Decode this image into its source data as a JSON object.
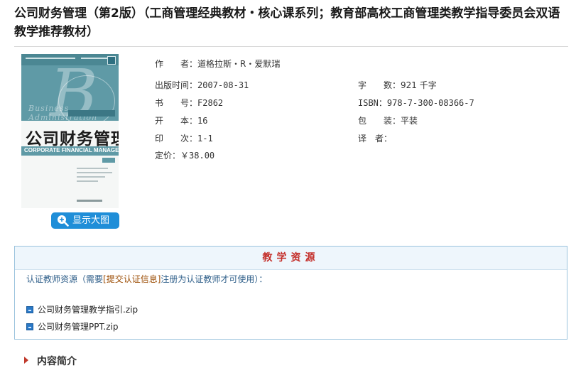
{
  "page_title": "公司财务管理（第2版）（工商管理经典教材・核心课系列；教育部高校工商管理类教学指导委员会双语教学推荐教材）",
  "cover": {
    "chinese_title": "公司财务管理",
    "english_title": "CORPORATE FINANCIAL MANAGEMENT",
    "enlarge_button": "显示大图"
  },
  "details": {
    "author_label": "作　　者：",
    "author_value": "道格拉斯・R・爱默瑞",
    "pubdate_label": "出版时间：",
    "pubdate_value": "2007-08-31",
    "wordcount_label": "字　　数：",
    "wordcount_value": "921 千字",
    "bookno_label": "书　　号：",
    "bookno_value": "F2862",
    "isbn_label": "ISBN：",
    "isbn_value": "978-7-300-08366-7",
    "format_label": "开　　本：",
    "format_value": "16",
    "binding_label": "包　　装：",
    "binding_value": "平装",
    "printing_label": "印　　次：",
    "printing_value": "1-1",
    "translator_label": "译　者：",
    "translator_value": "",
    "price_label": "定价：",
    "price_value": "￥38.00"
  },
  "resources": {
    "header": "教学资源",
    "note_before": "认证教师资源（需要",
    "note_link": "[提交认证信息]",
    "note_after": "注册为认证教师才可使用）：",
    "files": [
      "公司财务管理教学指引.zip",
      "公司财务管理PPT.zip"
    ]
  },
  "section": {
    "intro_heading": "内容简介"
  },
  "colors": {
    "accent_red": "#c4302b",
    "button_blue": "#1f8ed8",
    "box_border": "#9bc3dd"
  }
}
